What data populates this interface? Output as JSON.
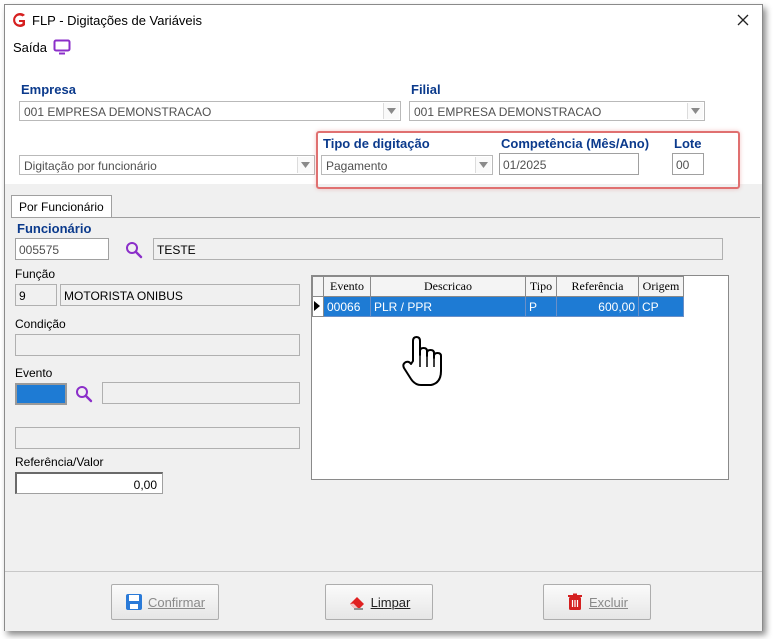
{
  "window": {
    "title": "FLP - Digitações de Variáveis"
  },
  "menu": {
    "exit_label": "Saída"
  },
  "header": {
    "empresa_label": "Empresa",
    "empresa_value": "001 EMPRESA DEMONSTRACAO",
    "filial_label": "Filial",
    "filial_value": "001 EMPRESA DEMONSTRACAO",
    "modo_value": "Digitação por funcionário",
    "tipo_label": "Tipo de digitação",
    "tipo_value": "Pagamento",
    "competencia_label": "Competência (Mês/Ano)",
    "competencia_value": "01/2025",
    "lote_label": "Lote",
    "lote_value": "00"
  },
  "tabs": [
    {
      "label": "Por Funcionário",
      "active": true
    }
  ],
  "form": {
    "funcionario_label": "Funcionário",
    "funcionario_code": "005575",
    "funcionario_name": "TESTE",
    "funcao_label": "Função",
    "funcao_code": "9",
    "funcao_name": "MOTORISTA ONIBUS",
    "condicao_label": "Condição",
    "condicao_value": "",
    "evento_label": "Evento",
    "evento_desc": "",
    "evento_extra": "",
    "referencia_label": "Referência/Valor",
    "referencia_value": "0,00"
  },
  "grid": {
    "columns": [
      "Evento",
      "Descricao",
      "Tipo",
      "Referência",
      "Origem"
    ],
    "rows": [
      {
        "evento": "00066",
        "descricao": "PLR / PPR",
        "tipo": "P",
        "referencia": "600,00",
        "origem": "CP",
        "selected": true
      }
    ]
  },
  "buttons": {
    "confirmar": "Confirmar",
    "limpar": "Limpar",
    "excluir": "Excluir"
  },
  "colors": {
    "accent_blue": "#1e7bd4",
    "label_blue": "#0b3a8c",
    "highlight_red": "#e07070",
    "icon_purple": "#8b2fc9"
  },
  "icons": {
    "app": "app-logo-icon",
    "close": "close-icon",
    "exit": "monitor-icon",
    "search": "search-icon",
    "save": "floppy-disk-icon",
    "eraser": "eraser-icon",
    "trash": "trash-icon",
    "cursor": "hand-cursor-icon"
  }
}
